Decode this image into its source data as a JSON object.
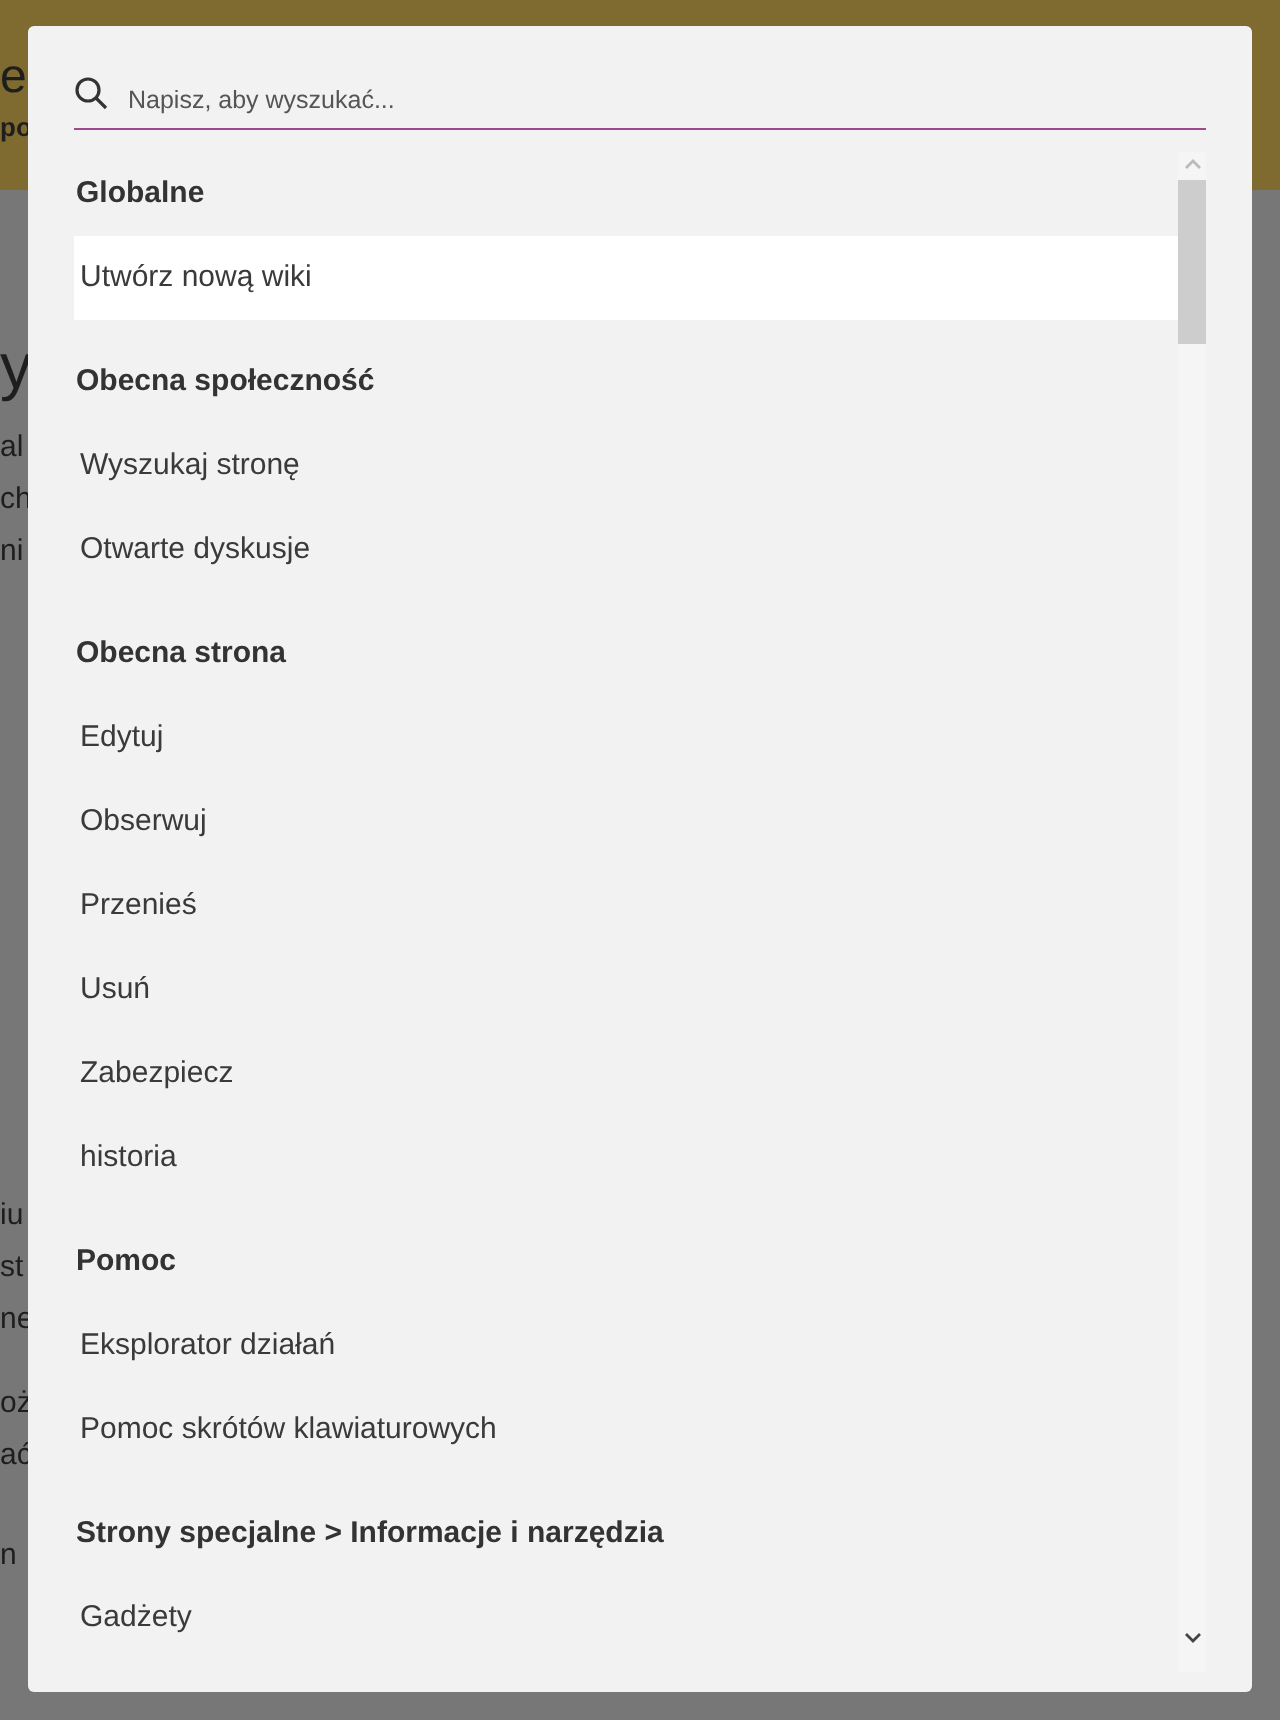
{
  "background": {
    "fragments": [
      {
        "text": "e",
        "kind": "title"
      },
      {
        "text": "po",
        "kind": "bold"
      },
      {
        "text": "y",
        "kind": "heading"
      },
      {
        "text": "al",
        "kind": "body"
      },
      {
        "text": "ch",
        "kind": "body"
      },
      {
        "text": "ni",
        "kind": "body"
      },
      {
        "text": "iu",
        "kind": "body"
      },
      {
        "text": "st",
        "kind": "body"
      },
      {
        "text": "ne",
        "kind": "body"
      },
      {
        "text": "oż",
        "kind": "body"
      },
      {
        "text": "ać",
        "kind": "body"
      },
      {
        "text": "n",
        "kind": "body"
      }
    ]
  },
  "search": {
    "placeholder": "Napisz, aby wyszukać..."
  },
  "sections": [
    {
      "title": "Globalne",
      "items": [
        {
          "label": "Utwórz nową wiki",
          "selected": true
        }
      ]
    },
    {
      "title": "Obecna społeczność",
      "items": [
        {
          "label": "Wyszukaj stronę",
          "selected": false
        },
        {
          "label": "Otwarte dyskusje",
          "selected": false
        }
      ]
    },
    {
      "title": "Obecna strona",
      "items": [
        {
          "label": "Edytuj",
          "selected": false
        },
        {
          "label": "Obserwuj",
          "selected": false
        },
        {
          "label": "Przenieś",
          "selected": false
        },
        {
          "label": "Usuń",
          "selected": false
        },
        {
          "label": "Zabezpiecz",
          "selected": false
        },
        {
          "label": "historia",
          "selected": false
        }
      ]
    },
    {
      "title": "Pomoc",
      "items": [
        {
          "label": "Eksplorator działań",
          "selected": false
        },
        {
          "label": "Pomoc skrótów klawiaturowych",
          "selected": false
        }
      ]
    },
    {
      "title": "Strony specjalne > Informacje i narzędzia",
      "items": [
        {
          "label": "Gadżety",
          "selected": false
        }
      ]
    }
  ]
}
